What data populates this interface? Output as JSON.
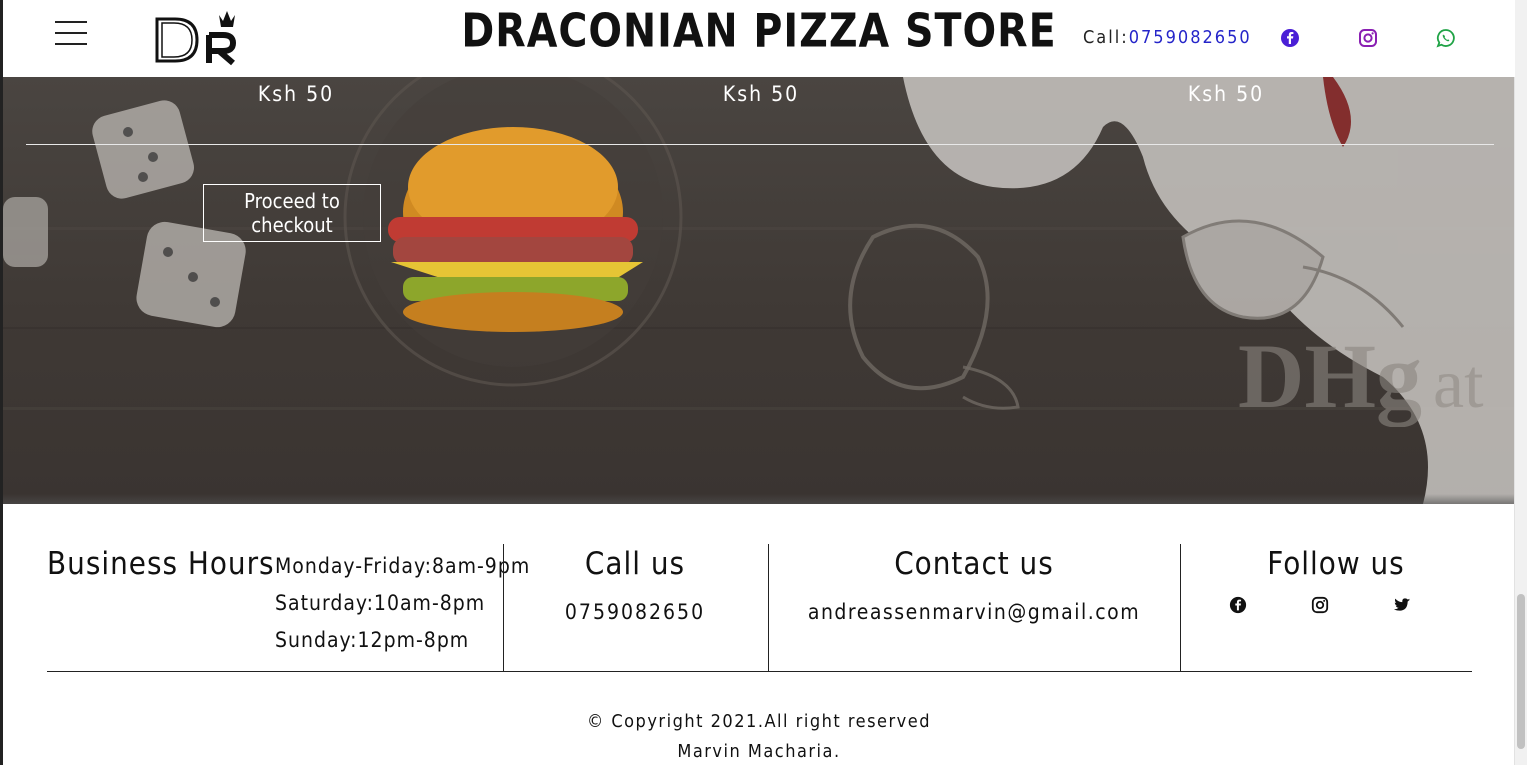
{
  "header": {
    "logo_text": "DR",
    "brand": "DRACONIAN PIZZA STORE",
    "call_label": "Call:",
    "phone": "0759082650",
    "social_icons": [
      "facebook-icon",
      "instagram-icon",
      "whatsapp-icon"
    ],
    "colors": {
      "facebook": "#4a1fd6",
      "instagram": "#8a1fb3",
      "whatsapp": "#20a346",
      "link": "#2525c9"
    }
  },
  "cart": {
    "prices": [
      "Ksh 50",
      "Ksh 50",
      "Ksh 50"
    ],
    "checkout_label": "Proceed to checkout"
  },
  "footer": {
    "business_hours_title": "Business Hours",
    "hours": [
      "Monday-Friday:8am-9pm",
      "Saturday:10am-8pm",
      "Sunday:12pm-8pm"
    ],
    "call_title": "Call us",
    "call_number": "0759082650",
    "contact_title": "Contact us",
    "email": "andreassenmarvin@gmail.com",
    "follow_title": "Follow us",
    "follow_icons": [
      "facebook-icon",
      "instagram-icon",
      "twitter-icon"
    ],
    "copyright": "© Copyright 2021.All right reserved",
    "author": "Marvin Macharia."
  }
}
